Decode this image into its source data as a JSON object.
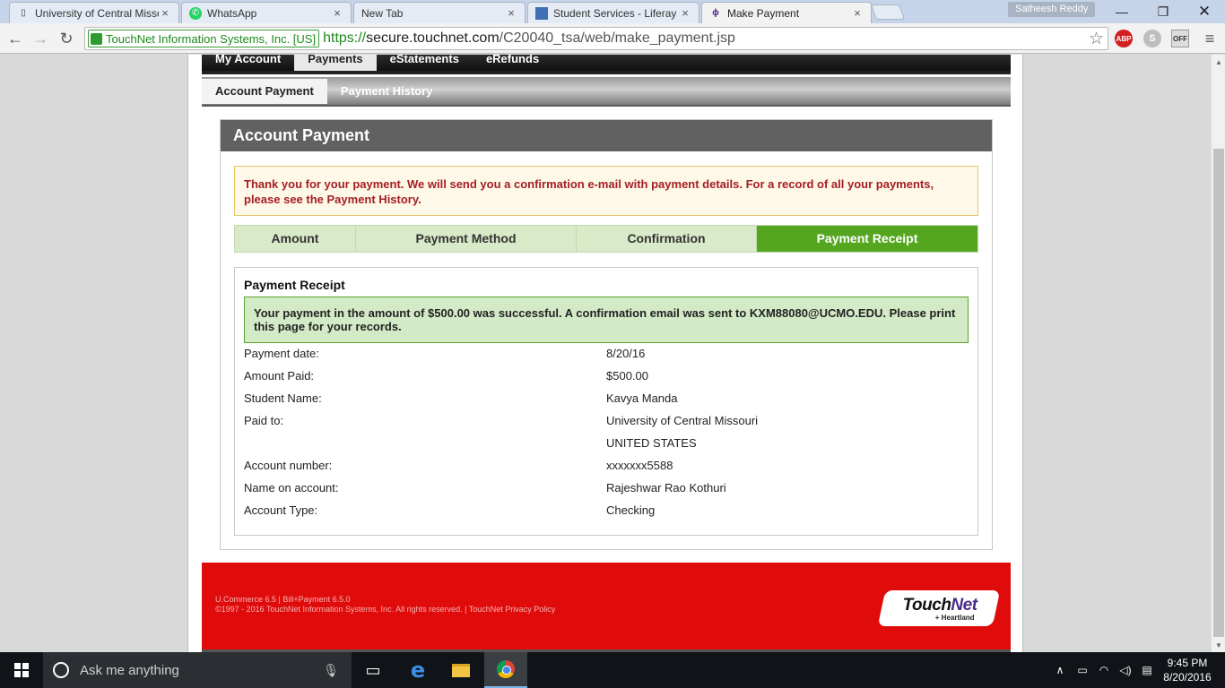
{
  "browser": {
    "tabs": [
      {
        "title": "University of Central Missouri",
        "favicon": "page-icon",
        "close": "×"
      },
      {
        "title": "WhatsApp",
        "favicon": "whatsapp-icon",
        "close": "×"
      },
      {
        "title": "New Tab",
        "favicon": "",
        "close": "×"
      },
      {
        "title": "Student Services - Liferay",
        "favicon": "liferay-icon",
        "close": "×"
      },
      {
        "title": "Make Payment",
        "favicon": "touchnet-icon",
        "close": "×"
      }
    ],
    "profile_name": "Satheesh Reddy",
    "secure_label": "TouchNet Information Systems, Inc. [US]",
    "url_proto": "https://",
    "url_host": "secure.touchnet.com",
    "url_path": "/C20040_tsa/web/make_payment.jsp",
    "ext_abp": "ABP",
    "ext_skype": "S",
    "ext_off": "OFF"
  },
  "nav": {
    "main": [
      "My Account",
      "Payments",
      "eStatements",
      "eRefunds"
    ],
    "sub": [
      "Account Payment",
      "Payment History"
    ]
  },
  "panel": {
    "title": "Account Payment",
    "notice": "Thank you for your payment. We will send you a confirmation e-mail with payment details. For a record of all your payments, please see the Payment History.",
    "steps": [
      "Amount",
      "Payment Method",
      "Confirmation",
      "Payment Receipt"
    ],
    "active_step": "Payment Receipt"
  },
  "receipt": {
    "heading": "Payment Receipt",
    "success_message": "Your payment in the amount of $500.00 was successful.  A confirmation email was sent to KXM88080@UCMO.EDU.  Please print this page for your records.",
    "rows": [
      {
        "label": "Payment date:",
        "value": "8/20/16"
      },
      {
        "label": "Amount Paid:",
        "value": "$500.00"
      },
      {
        "label": "Student Name:",
        "value": "Kavya Manda"
      },
      {
        "label": "Paid to:",
        "value": "University of Central Missouri"
      },
      {
        "label": "",
        "value": "UNITED STATES"
      },
      {
        "label": "Account number:",
        "value": "xxxxxxx5588"
      },
      {
        "label": "Name on account:",
        "value": "Rajeshwar Rao Kothuri"
      },
      {
        "label": "Account Type:",
        "value": "Checking"
      }
    ]
  },
  "footer": {
    "version": "U.Commerce 6.5 | Bill+Payment 6.5.0",
    "copyright": "©1997 - 2016  TouchNet Information Systems, Inc. All rights reserved.  |  TouchNet Privacy Policy",
    "logo_main": "Touch",
    "logo_net": "Net",
    "logo_sub": "+ Heartland"
  },
  "taskbar": {
    "search_placeholder": "Ask me anything",
    "time": "9:45 PM",
    "date": "8/20/2016"
  },
  "colors": {
    "active_step": "#55a61f",
    "footer": "#e00b0b",
    "notice_text": "#a41e22"
  }
}
